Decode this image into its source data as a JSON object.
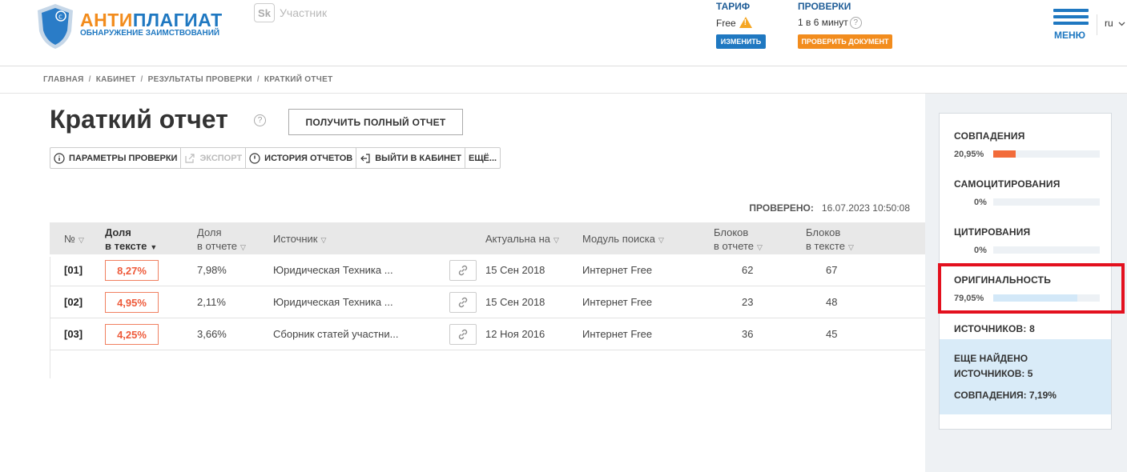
{
  "header": {
    "logo_title_a": "АНТИ",
    "logo_title_b": "ПЛАГИАТ",
    "logo_subtitle": "ОБНАРУЖЕНИЕ ЗАИМСТВОВАНИЙ",
    "sk_label": "Sk",
    "sk_text": "Участник",
    "tariff_label": "ТАРИФ",
    "tariff_value": "Free",
    "change_button": "ИЗМЕНИТЬ",
    "checks_label": "ПРОВЕРКИ",
    "checks_value": "1 в 6 минут",
    "check_doc_button": "ПРОВЕРИТЬ ДОКУМЕНТ",
    "menu_label": "МЕНЮ",
    "lang": "ru"
  },
  "breadcrumbs": [
    "ГЛАВНАЯ",
    "КАБИНЕТ",
    "РЕЗУЛЬТАТЫ ПРОВЕРКИ",
    "КРАТКИЙ ОТЧЕТ"
  ],
  "page": {
    "title": "Краткий отчет",
    "full_report_button": "ПОЛУЧИТЬ ПОЛНЫЙ ОТЧЕТ",
    "toolbar": {
      "params": "ПАРАМЕТРЫ ПРОВЕРКИ",
      "export": "ЭКСПОРТ",
      "history": "ИСТОРИЯ ОТЧЕТОВ",
      "exit": "ВЫЙТИ В КАБИНЕТ",
      "more": "ЕЩЁ..."
    },
    "checked_label": "ПРОВЕРЕНО:",
    "checked_value": "16.07.2023 10:50:08"
  },
  "table": {
    "headers": {
      "num": "№",
      "share_text_1": "Доля",
      "share_text_2": "в тексте",
      "share_report_1": "Доля",
      "share_report_2": "в отчете",
      "source": "Источник",
      "actual": "Актуальна на",
      "module": "Модуль поиска",
      "blocks_report_1": "Блоков",
      "blocks_report_2": "в отчете",
      "blocks_text_1": "Блоков",
      "blocks_text_2": "в тексте"
    },
    "rows": [
      {
        "num": "[01]",
        "share_text": "8,27%",
        "share_report": "7,98%",
        "source": "Юридическая Техника ...",
        "actual": "15 Сен 2018",
        "module": "Интернет Free",
        "blocks_report": "62",
        "blocks_text": "67"
      },
      {
        "num": "[02]",
        "share_text": "4,95%",
        "share_report": "2,11%",
        "source": "Юридическая Техника ...",
        "actual": "15 Сен 2018",
        "module": "Интернет Free",
        "blocks_report": "23",
        "blocks_text": "48"
      },
      {
        "num": "[03]",
        "share_text": "4,25%",
        "share_report": "3,66%",
        "source": "Сборник статей участни...",
        "actual": "12 Ноя 2016",
        "module": "Интернет Free",
        "blocks_report": "36",
        "blocks_text": "45"
      }
    ]
  },
  "stats": {
    "matches_label": "СОВПАДЕНИЯ",
    "matches_value": "20,95%",
    "matches_fraction": 0.2095,
    "matches_color": "#f26b3a",
    "selfcite_label": "САМОЦИТИРОВАНИЯ",
    "selfcite_value": "0%",
    "cite_label": "ЦИТИРОВАНИЯ",
    "cite_value": "0%",
    "orig_label": "ОРИГИНАЛЬНОСТЬ",
    "orig_value": "79,05%",
    "orig_fraction": 0.7905,
    "orig_color": "#d3e8f8",
    "sources_label": "ИСТОЧНИКОВ:",
    "sources_value": "8",
    "found_label_1": "ЕЩЕ НАЙДЕНО",
    "found_label_2": "ИСТОЧНИКОВ:",
    "found_sources_value": "5",
    "found_matches_label": "СОВПАДЕНИЯ:",
    "found_matches_value": "7,19%"
  }
}
